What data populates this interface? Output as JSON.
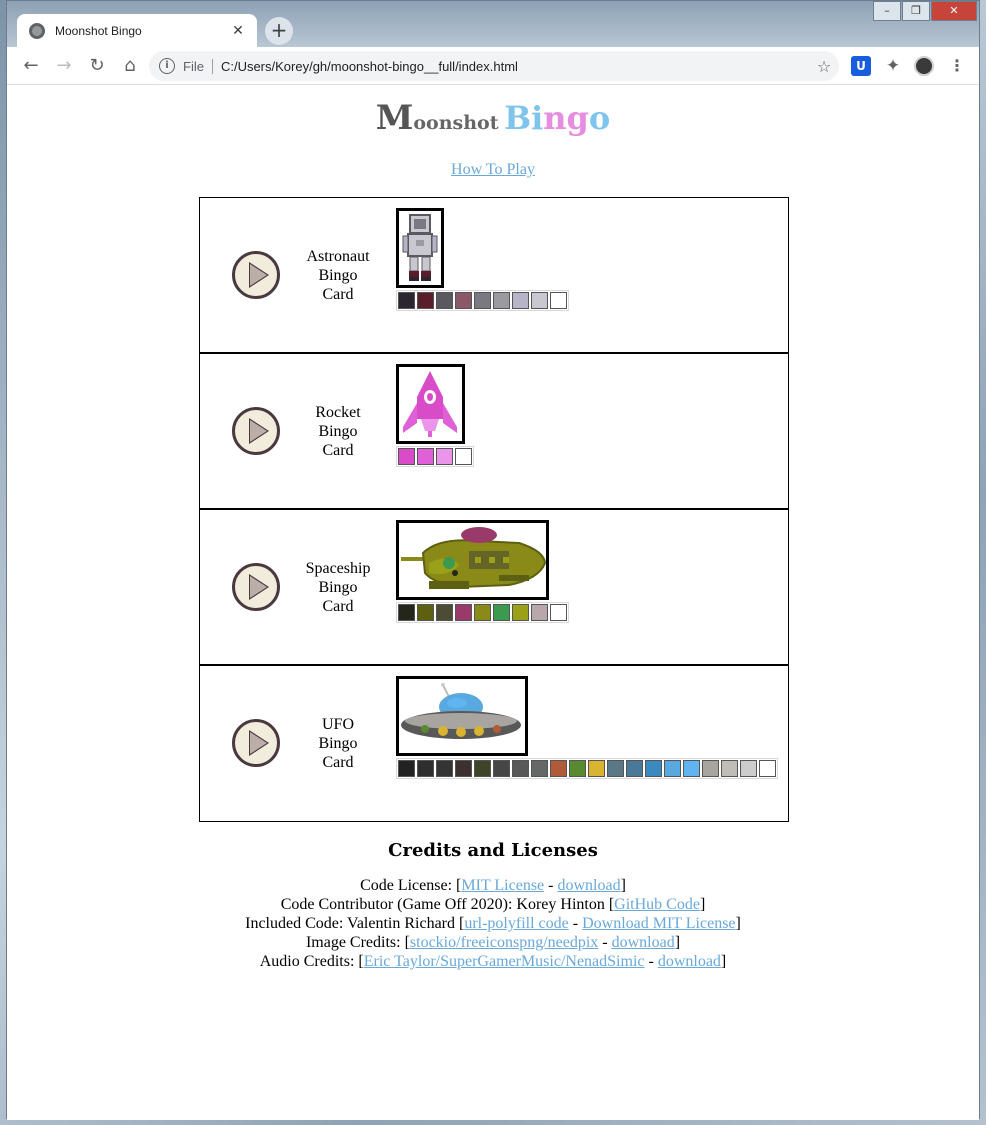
{
  "browser": {
    "tab_title": "Moonshot Bingo",
    "scheme_label": "File",
    "url": "C:/Users/Korey/gh/moonshot-bingo__full/index.html"
  },
  "logo": {
    "m": "M",
    "oonshot": "oonshot",
    "b1": "Bi",
    "b2": "ng",
    "b3": "o"
  },
  "how_to_play": "How To Play",
  "cards": [
    {
      "label": [
        "Astronaut",
        "Bingo",
        "Card"
      ],
      "sprite_icon": "astronaut-icon",
      "palette": [
        "#2b2630",
        "#5a1e2a",
        "#5b5860",
        "#8a5868",
        "#7a7880",
        "#9a9aa0",
        "#b8b4c8",
        "#c9c8d0",
        "#ffffff"
      ]
    },
    {
      "label": [
        "Rocket",
        "Bingo",
        "Card"
      ],
      "sprite_icon": "rocket-icon",
      "palette": [
        "#d84cc8",
        "#e060d8",
        "#ea94ea",
        "#ffffff"
      ]
    },
    {
      "label": [
        "Spaceship",
        "Bingo",
        "Card"
      ],
      "sprite_icon": "spaceship-icon",
      "palette": [
        "#24261c",
        "#5c6010",
        "#4c4c34",
        "#9a3a6a",
        "#8a8a18",
        "#3c9a50",
        "#9aa018",
        "#b8a8ac",
        "#ffffff"
      ]
    },
    {
      "label": [
        "UFO",
        "Bingo",
        "Card"
      ],
      "sprite_icon": "ufo-icon",
      "palette": [
        "#222222",
        "#2e2e2e",
        "#343434",
        "#3e3030",
        "#3e4428",
        "#464646",
        "#585858",
        "#666868",
        "#b05a3a",
        "#5a8a30",
        "#d8b430",
        "#5a7888",
        "#4a7898",
        "#3a8ac0",
        "#5aa8e0",
        "#60b4f0",
        "#a8a4a0",
        "#c0bcb8",
        "#cccccc",
        "#ffffff"
      ]
    }
  ],
  "credits": {
    "title": "Credits and Licenses",
    "code_license_label": "Code License: [",
    "code_license_link": "MIT License",
    "sep1": " - ",
    "code_license_download": "download",
    "close1": "]",
    "contributor_label": "Code Contributor (Game Off 2020): Korey Hinton [",
    "contributor_link": "GitHub Code",
    "close2": "]",
    "included_label": "Included Code: Valentin Richard [",
    "included_link": "url-polyfill code",
    "sep3": " - ",
    "included_download": "Download MIT License",
    "close3": "]",
    "image_label": "Image Credits: [",
    "image_link": "stockio/freeiconspng/needpix",
    "sep4": " - ",
    "image_download": "download",
    "close4": "]",
    "audio_label": "Audio Credits: [",
    "audio_link": "Eric Taylor/SuperGamerMusic/NenadSimic",
    "sep5": " - ",
    "audio_download": "download",
    "close5": "]"
  }
}
